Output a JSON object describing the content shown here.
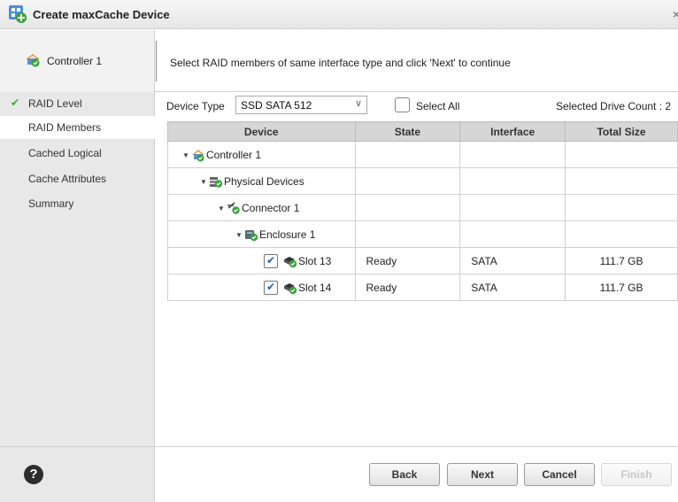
{
  "window": {
    "title": "Create maxCache Device",
    "close_glyph": "×"
  },
  "header": {
    "controller_label": "Controller 1",
    "instruction": "Select RAID members of same interface type and click 'Next' to continue"
  },
  "sidebar": {
    "items": [
      {
        "label": "RAID Level",
        "completed": true,
        "check": "✔"
      },
      {
        "label": "RAID Members",
        "completed": false,
        "active": true
      },
      {
        "label": "Cached Logical",
        "completed": false
      },
      {
        "label": "Cache Attributes",
        "completed": false
      },
      {
        "label": "Summary",
        "completed": false
      }
    ]
  },
  "toolbar": {
    "device_type_label": "Device Type",
    "device_type_value": "SSD SATA 512",
    "select_all_label": "Select All",
    "select_all_checked": false,
    "selected_count_text": "Selected Drive Count : 2"
  },
  "table": {
    "columns": [
      "Device",
      "State",
      "Interface",
      "Total Size"
    ],
    "rows": [
      {
        "level": 0,
        "expanded": true,
        "icon": "controller-icon",
        "label": "Controller 1",
        "state": "",
        "interface": "",
        "size": ""
      },
      {
        "level": 1,
        "expanded": true,
        "icon": "physical-devices-icon",
        "label": "Physical Devices",
        "state": "",
        "interface": "",
        "size": ""
      },
      {
        "level": 2,
        "expanded": true,
        "icon": "connector-icon",
        "label": "Connector 1",
        "state": "",
        "interface": "",
        "size": ""
      },
      {
        "level": 3,
        "expanded": true,
        "icon": "enclosure-icon",
        "label": "Enclosure 1",
        "state": "",
        "interface": "",
        "size": ""
      },
      {
        "level": 4,
        "checked": true,
        "icon": "drive-icon",
        "label": "Slot 13",
        "state": "Ready",
        "interface": "SATA",
        "size": "111.7 GB"
      },
      {
        "level": 4,
        "checked": true,
        "icon": "drive-icon",
        "label": "Slot 14",
        "state": "Ready",
        "interface": "SATA",
        "size": "111.7 GB"
      }
    ]
  },
  "footer": {
    "help_glyph": "?",
    "back_label": "Back",
    "next_label": "Next",
    "cancel_label": "Cancel",
    "finish_label": "Finish",
    "finish_enabled": false
  },
  "colors": {
    "accent_check": "#3aa33a",
    "checkbox_tick": "#2b5aa8",
    "header_bg": "#d6d6d6"
  }
}
